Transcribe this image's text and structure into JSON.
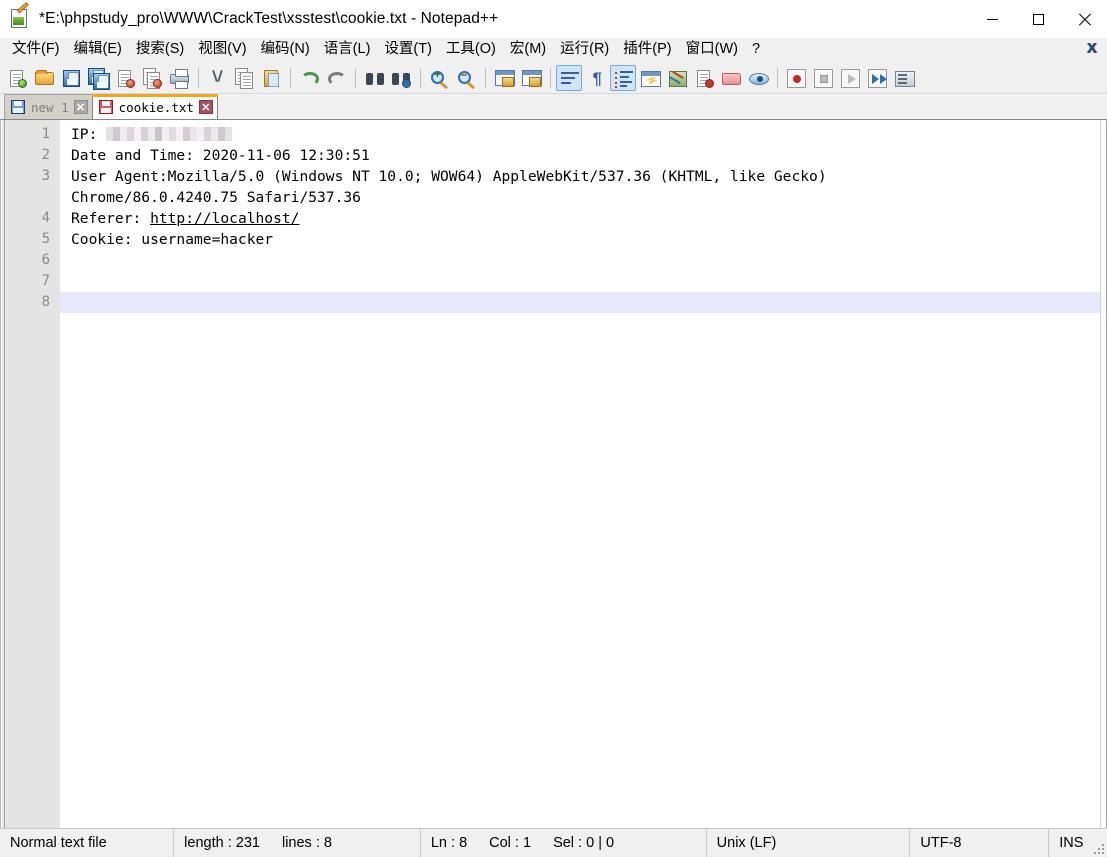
{
  "window": {
    "title": "*E:\\phpstudy_pro\\WWW\\CrackTest\\xsstest\\cookie.txt - Notepad++",
    "app_icon": "notepadpp-icon",
    "minimize_label": "–",
    "maximize_label": "□",
    "close_label": "✕"
  },
  "menubar": {
    "items": [
      {
        "label": "文件(F)",
        "name": "menu-file"
      },
      {
        "label": "编辑(E)",
        "name": "menu-edit"
      },
      {
        "label": "搜索(S)",
        "name": "menu-search"
      },
      {
        "label": "视图(V)",
        "name": "menu-view"
      },
      {
        "label": "编码(N)",
        "name": "menu-encoding"
      },
      {
        "label": "语言(L)",
        "name": "menu-language"
      },
      {
        "label": "设置(T)",
        "name": "menu-settings"
      },
      {
        "label": "工具(O)",
        "name": "menu-tools"
      },
      {
        "label": "宏(M)",
        "name": "menu-macro"
      },
      {
        "label": "运行(R)",
        "name": "menu-run"
      },
      {
        "label": "插件(P)",
        "name": "menu-plugins"
      },
      {
        "label": "窗口(W)",
        "name": "menu-window"
      },
      {
        "label": "?",
        "name": "menu-help"
      }
    ],
    "doc_close_label": "X"
  },
  "toolbar": {
    "icons": [
      "new-file-icon",
      "open-file-icon",
      "save-icon",
      "save-all-icon",
      "close-file-icon",
      "close-all-icon",
      "print-icon",
      "cut-icon",
      "copy-icon",
      "paste-icon",
      "undo-icon",
      "redo-icon",
      "find-icon",
      "replace-icon",
      "zoom-in-icon",
      "zoom-out-icon",
      "sync-vertical-icon",
      "sync-horizontal-icon",
      "word-wrap-icon",
      "show-all-characters-icon",
      "indent-guide-icon",
      "user-defined-dialog-icon",
      "document-map-icon",
      "function-list-icon",
      "folder-as-workspace-icon",
      "monitoring-icon",
      "record-macro-icon",
      "stop-recording-icon",
      "play-macro-icon",
      "run-macro-multiple-icon",
      "run-icon"
    ]
  },
  "tabs": [
    {
      "label": "new 1",
      "name": "tab-new-1",
      "active": false,
      "icon": "save-blue-icon",
      "close_label": "✕"
    },
    {
      "label": "cookie.txt",
      "name": "tab-cookie-txt",
      "active": true,
      "icon": "save-red-icon",
      "close_label": "✕"
    }
  ],
  "editor": {
    "line_numbers": [
      "1",
      "2",
      "3",
      "4",
      "5",
      "6",
      "7",
      "8"
    ],
    "lines": [
      {
        "num": "1",
        "prefix": "IP: ",
        "redacted": true,
        "suffix": ""
      },
      {
        "num": "2",
        "text": "Date and Time: 2020-11-06 12:30:51"
      },
      {
        "num": "3",
        "text": "User Agent:Mozilla/5.0 (Windows NT 10.0; WOW64) AppleWebKit/537.36 (KHTML, like Gecko)"
      },
      {
        "num": "3w",
        "text": "Chrome/86.0.4240.75 Safari/537.36",
        "wrapped": true
      },
      {
        "num": "4",
        "prefix": "Referer: ",
        "link": "http://localhost/"
      },
      {
        "num": "5",
        "text": "Cookie: username=hacker"
      },
      {
        "num": "6",
        "text": ""
      },
      {
        "num": "7",
        "text": ""
      },
      {
        "num": "8",
        "text": "",
        "current": true
      }
    ],
    "current_line": 8,
    "current_line_color": "#e8e8fb"
  },
  "statusbar": {
    "file_type": "Normal text file",
    "length_label": "length : 231",
    "lines_label": "lines : 8",
    "ln_label": "Ln : 8",
    "col_label": "Col : 1",
    "sel_label": "Sel : 0 | 0",
    "eol": "Unix (LF)",
    "encoding": "UTF-8",
    "insert_mode": "INS"
  },
  "colors": {
    "tab_active_accent": "#f2a71b",
    "gutter_bg": "#e4e4e4",
    "current_line": "#e8e8fb",
    "chrome_bg": "#f0f0f0"
  }
}
